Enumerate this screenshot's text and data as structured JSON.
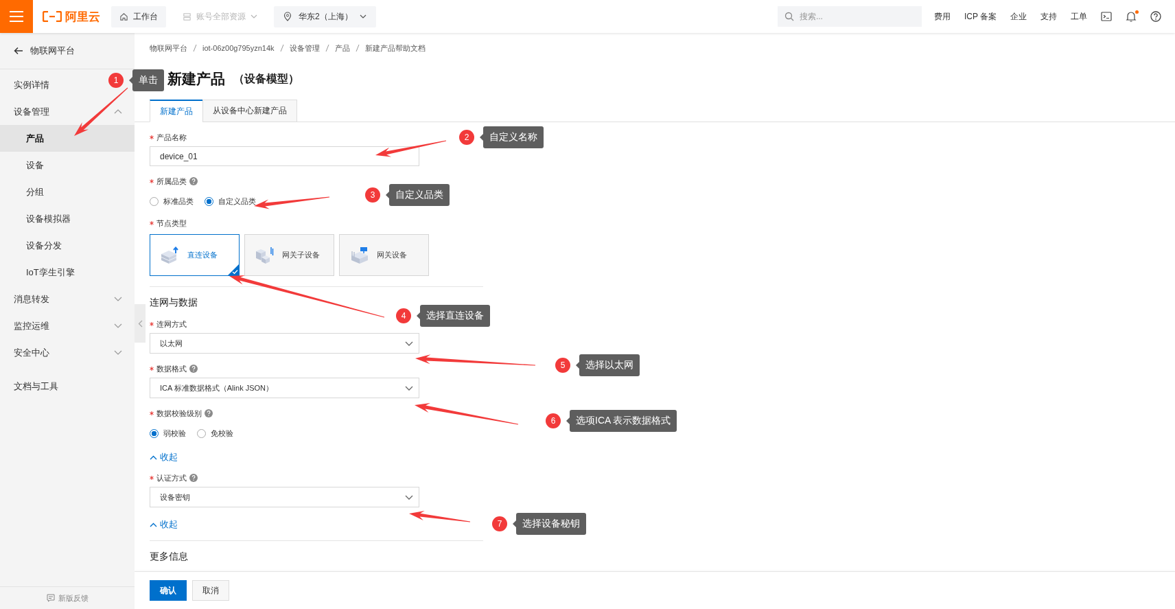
{
  "top_bar": {
    "logo_text": "阿里云",
    "workbench": "工作台",
    "resources": {
      "label": "账号全部资源",
      "disabled": true
    },
    "region": "华东2（上海）",
    "search": {
      "placeholder": "搜索..."
    },
    "links": [
      "费用",
      "ICP 备案",
      "企业",
      "支持",
      "工单"
    ],
    "notification_dot": true
  },
  "sidebar": {
    "back": "物联网平台",
    "items": [
      {
        "kind": "item",
        "label": "实例详情",
        "selected": false
      },
      {
        "kind": "group",
        "label": "设备管理",
        "selected": false,
        "expanded": true,
        "children": [
          {
            "label": "产品",
            "selected": true
          },
          {
            "label": "设备",
            "selected": false
          },
          {
            "label": "分组",
            "selected": false
          },
          {
            "label": "设备模拟器",
            "selected": false
          },
          {
            "label": "设备分发",
            "selected": false
          },
          {
            "label": "IoT孪生引擎",
            "selected": false
          }
        ]
      },
      {
        "kind": "group",
        "label": "消息转发",
        "selected": false,
        "expanded": false
      },
      {
        "kind": "group",
        "label": "监控运维",
        "selected": false,
        "expanded": false
      },
      {
        "kind": "group",
        "label": "安全中心",
        "selected": false,
        "expanded": false
      },
      {
        "kind": "link",
        "label": "文档与工具",
        "selected": false
      }
    ],
    "feedback": "新版反馈"
  },
  "breadcrumb": [
    "物联网平台",
    "iot-06z00g795yzn14k",
    "设备管理",
    "产品",
    "新建产品帮助文档"
  ],
  "title": "新建产品",
  "subtitle": "（设备模型）",
  "tabs": [
    {
      "label": "新建产品",
      "selected": true
    },
    {
      "label": "从设备中心新建产品",
      "selected": false
    }
  ],
  "fields": [
    {
      "kind": "input",
      "label": "产品名称",
      "required": true,
      "help": false,
      "value": "device_01"
    },
    {
      "kind": "radio",
      "label": "所属品类",
      "required": true,
      "help": true,
      "options": [
        {
          "label": "标准品类",
          "selected": false
        },
        {
          "label": "自定义品类",
          "selected": true
        }
      ]
    },
    {
      "kind": "cards",
      "label": "节点类型",
      "required": true,
      "help": false,
      "options": [
        {
          "label": "直连设备",
          "selected": true
        },
        {
          "label": "网关子设备",
          "selected": false
        },
        {
          "label": "网关设备",
          "selected": false
        }
      ]
    },
    {
      "kind": "section",
      "title": "连网与数据"
    },
    {
      "kind": "select",
      "label": "连网方式",
      "required": true,
      "help": false,
      "value": "以太网"
    },
    {
      "kind": "select",
      "label": "数据格式",
      "required": true,
      "help": true,
      "value": "ICA 标准数据格式（Alink JSON）"
    },
    {
      "kind": "radio",
      "label": "数据校验级别",
      "required": true,
      "help": true,
      "options": [
        {
          "label": "弱校验",
          "selected": true
        },
        {
          "label": "免校验",
          "selected": false
        }
      ]
    },
    {
      "kind": "collapse",
      "label": "收起"
    },
    {
      "kind": "select",
      "label": "认证方式",
      "required": true,
      "help": true,
      "value": "设备密钥"
    },
    {
      "kind": "collapse",
      "label": "收起"
    },
    {
      "kind": "section",
      "title": "更多信息"
    }
  ],
  "footer_buttons": [
    {
      "label": "确认",
      "kind": "primary"
    },
    {
      "label": "取消",
      "kind": "default"
    }
  ],
  "callouts": [
    {
      "number": "1",
      "text": "单击"
    },
    {
      "number": "2",
      "text": "自定义名称"
    },
    {
      "number": "3",
      "text": "自定义品类"
    },
    {
      "number": "4",
      "text": "选择直连设备"
    },
    {
      "number": "5",
      "text": "选择以太网"
    },
    {
      "number": "6",
      "text": "选项ICA 表示数据格式"
    },
    {
      "number": "7",
      "text": "选择设备秘钥"
    }
  ]
}
